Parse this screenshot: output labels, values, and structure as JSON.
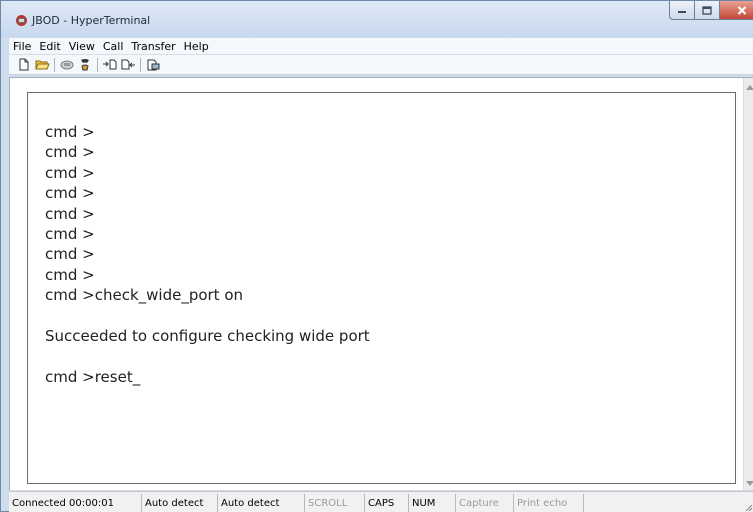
{
  "window": {
    "title": "JBOD - HyperTerminal"
  },
  "icons": {
    "app": "hyperterminal-app-icon",
    "minimize": "minimize-icon",
    "maximize": "maximize-icon",
    "close": "close-icon"
  },
  "menu": {
    "items": [
      "File",
      "Edit",
      "View",
      "Call",
      "Transfer",
      "Help"
    ]
  },
  "toolbar": {
    "buttons": [
      "new-document-icon",
      "open-folder-icon",
      "disconnect-icon",
      "dial-icon",
      "send-file-icon",
      "receive-file-icon",
      "properties-icon"
    ]
  },
  "terminal": {
    "lines": [
      "cmd >",
      "cmd >",
      "cmd >",
      "cmd >",
      "cmd >",
      "cmd >",
      "cmd >",
      "cmd >",
      "cmd >check_wide_port on",
      "",
      "Succeeded to configure checking wide port",
      "",
      "cmd >reset_"
    ]
  },
  "status": {
    "connected": "Connected 00:00:01",
    "detect1": "Auto detect",
    "detect2": "Auto detect",
    "scroll": "SCROLL",
    "caps": "CAPS",
    "num": "NUM",
    "capture": "Capture",
    "print_echo": "Print echo"
  },
  "colors": {
    "titlebar": "#c7d8ee",
    "close_button": "#c6493a",
    "terminal_bg": "#ffffff",
    "terminal_text": "#222222"
  }
}
